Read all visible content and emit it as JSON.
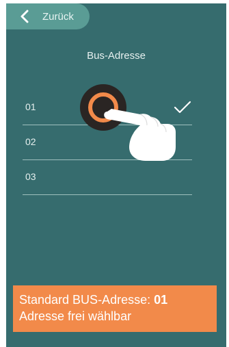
{
  "header": {
    "back_label": "Zurück"
  },
  "page": {
    "title": "Bus-Adresse"
  },
  "list": {
    "items": [
      {
        "label": "01",
        "selected": true
      },
      {
        "label": "02",
        "selected": false
      },
      {
        "label": "03",
        "selected": false
      }
    ]
  },
  "banner": {
    "line1_prefix": "Standard BUS-Adresse: ",
    "line1_value": "01",
    "line2": "Adresse frei wählbar"
  },
  "icons": {
    "back": "chevron-left-icon",
    "check": "checkmark-icon",
    "hand": "pointing-hand-icon",
    "tap": "tap-ring-icon"
  },
  "colors": {
    "screen_bg": "#366c6e",
    "back_button_bg": "#5a9c95",
    "banner_bg": "#f28a4a",
    "tap_ring": "#f28a4a"
  }
}
